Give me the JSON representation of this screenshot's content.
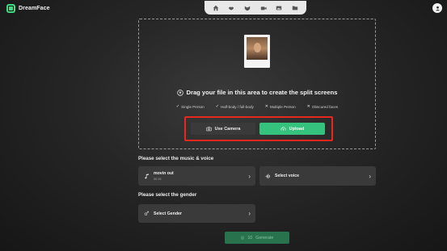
{
  "header": {
    "app_name": "DreamFace",
    "toolbar_icons": [
      "home-icon",
      "lips-icon",
      "mask-icon",
      "video-icon",
      "image-icon",
      "folder-icon"
    ],
    "avatar_icon": "user-icon"
  },
  "upload": {
    "title": "Drag your file in this area to create the split screens",
    "features": [
      {
        "mark": "✓",
        "label": "Single Person"
      },
      {
        "mark": "✓",
        "label": "Half-body / full-body"
      },
      {
        "mark": "✕",
        "label": "Multiple Person"
      },
      {
        "mark": "✕",
        "label": "Obscured faces"
      }
    ],
    "camera_label": "Use Camera",
    "upload_label": "Upload",
    "highlight_color": "#e8271e"
  },
  "music": {
    "section_label": "Please select the music & voice",
    "music_title": "movin out",
    "music_duration": "00:15",
    "voice_label": "Select voice"
  },
  "gender": {
    "section_label": "Please select the gender",
    "select_label": "Select Gender"
  },
  "generate": {
    "count": "10",
    "label": "Generate"
  },
  "colors": {
    "accent": "#35c27c",
    "generate_disabled": "#28734d"
  }
}
